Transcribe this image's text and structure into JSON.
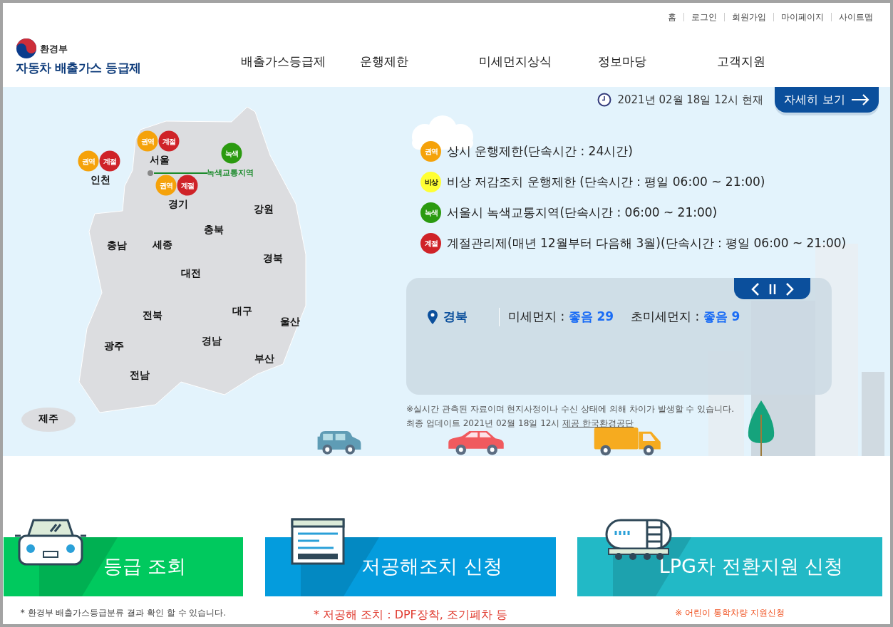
{
  "utility_links": [
    "홈",
    "로그인",
    "회원가입",
    "마이페이지",
    "사이트맵"
  ],
  "logo": {
    "ministry": "환경부",
    "title": "자동차 배출가스 등급제"
  },
  "nav": [
    "배출가스등급제",
    "운행제한",
    "미세먼지상식",
    "정보마당",
    "고객지원"
  ],
  "hero": {
    "timestamp": "2021년 02월 18일 12시 현재",
    "detail_button": "자세히 보기",
    "map": {
      "regions": [
        {
          "name": "서울",
          "badges": [
            {
              "label": "권역",
              "color": "#f5a20a"
            },
            {
              "label": "계절",
              "color": "#cf2328"
            }
          ]
        },
        {
          "name": "인천",
          "badges": [
            {
              "label": "권역",
              "color": "#f5a20a"
            },
            {
              "label": "계절",
              "color": "#cf2328"
            }
          ]
        },
        {
          "name": "경기",
          "badges": [
            {
              "label": "권역",
              "color": "#f5a20a"
            },
            {
              "label": "계절",
              "color": "#cf2328"
            }
          ]
        },
        {
          "name": "강원"
        },
        {
          "name": "충북"
        },
        {
          "name": "충남"
        },
        {
          "name": "세종"
        },
        {
          "name": "경북"
        },
        {
          "name": "대전"
        },
        {
          "name": "대구"
        },
        {
          "name": "울산"
        },
        {
          "name": "전북"
        },
        {
          "name": "광주"
        },
        {
          "name": "경남"
        },
        {
          "name": "부산"
        },
        {
          "name": "전남"
        },
        {
          "name": "제주"
        }
      ],
      "green_zone": {
        "badge": {
          "label": "녹색",
          "color": "#2b9a10"
        },
        "label": "녹색교통지역"
      }
    },
    "legend": [
      {
        "badge": "권역",
        "color": "#f5a20a",
        "text": "상시 운행제한(단속시간 : 24시간)"
      },
      {
        "badge": "비상",
        "color": "#ffff33",
        "text": "비상 저감조치 운행제한 (단속시간 : 평일 06:00 ~ 21:00)"
      },
      {
        "badge": "녹색",
        "color": "#2b9a10",
        "text": "서울시 녹색교통지역(단속시간 : 06:00 ~ 21:00)"
      },
      {
        "badge": "계절",
        "color": "#cf2328",
        "text": "계절관리제(매년 12월부터 다음해 3월)(단속시간 : 평일 06:00 ~ 21:00)"
      }
    ],
    "air_quality": {
      "region": "경북",
      "pm10_label": "미세먼지 :",
      "pm10_value": "좋음 29",
      "pm25_label": "초미세먼지 :",
      "pm25_value": "좋음 9"
    },
    "note": "※실시간 관측된 자료이며 현지사정이나 수신 상태에 의해 차이가 발생할 수 있습니다.",
    "update": {
      "text": "최종 업데이트 2021년 02월 18일 12시",
      "link": "제공 한국환경공단"
    }
  },
  "services": [
    {
      "kind": "car",
      "title": "등급 조회",
      "color": "#00c95e",
      "lines": [
        {
          "text": "* 환경부 배출가스등급분류 결과 확인 할 수 있습니다.",
          "color": "#444444"
        }
      ]
    },
    {
      "kind": "document",
      "title": "저공해조치 신청",
      "color": "#049cdd",
      "lines": [
        {
          "text": "* 저공해 조치 : DPF장착, 조기폐차 등",
          "color": "#e03a2e"
        }
      ]
    },
    {
      "kind": "tank",
      "title": "LPG차 전환지원 신청",
      "color": "#22b9c6",
      "lines": [
        {
          "text": "※ 어린이 통학차량 지원신청",
          "color": "#f0501e"
        }
      ]
    }
  ]
}
